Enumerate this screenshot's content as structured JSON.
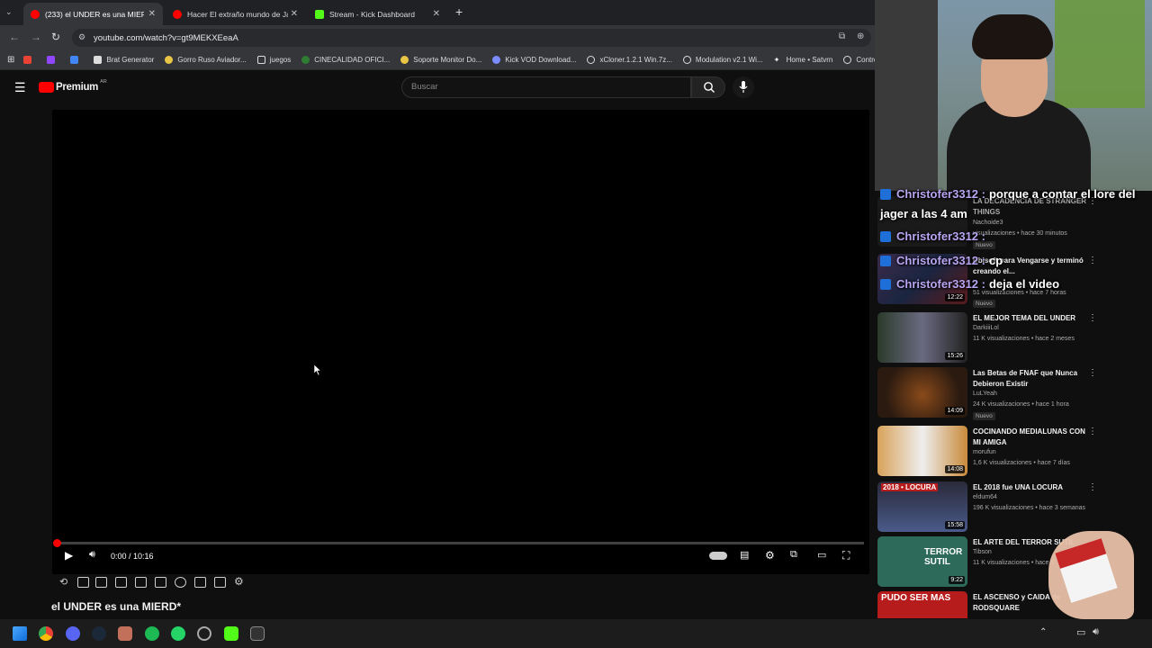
{
  "browser": {
    "tabs": [
      {
        "title": "(233) el UNDER es una MIERD*",
        "active": true
      },
      {
        "title": "Hacer El extraño mundo de Jac"
      },
      {
        "title": "Stream - Kick Dashboard"
      }
    ],
    "url": "youtube.com/watch?v=gt9MEKXEeaA",
    "bookmarks": [
      "Brat Generator",
      "Gorro Ruso Aviador...",
      "juegos",
      "CINECALIDAD OFICI...",
      "Soporte Monitor Do...",
      "Kick VOD Download...",
      "xCloner.1.2.1 Win.7z...",
      "Modulation v2.1 Wi...",
      "Home • Satvrn",
      "Control"
    ]
  },
  "youtube": {
    "logo": "Premium",
    "region": "AR",
    "search_placeholder": "Buscar"
  },
  "player": {
    "time": "0:00 / 10:16",
    "progress": 0
  },
  "video_title": "el UNDER es una MIERD*",
  "chat": [
    {
      "user": "Christofer3312 :",
      "msg": "porque a contar el lore del"
    },
    {
      "user": "",
      "msg": "jager a las 4 am"
    },
    {
      "user": "Christofer3312 :",
      "msg": ""
    },
    {
      "user": "Christofer3312 :",
      "msg": "cp"
    },
    {
      "user": "Christofer3312 :",
      "msg": "deja el video"
    }
  ],
  "sidebar": [
    {
      "title": "LA DECADENCIA DE STRANGER THINGS",
      "channel": "Nachoide3",
      "meta": "visualizaciones • hace 30 minutos",
      "badge": "Nuevo",
      "duration": ""
    },
    {
      "title": "Ubisoft para Vengarse y terminó creando el...",
      "channel": "",
      "meta": "51 visualizaciones • hace 7 horas",
      "badge": "Nuevo",
      "duration": "12:22"
    },
    {
      "title": "EL MEJOR TEMA DEL UNDER",
      "channel": "DarkiiiLol",
      "meta": "11 K visualizaciones • hace 2 meses",
      "badge": "",
      "duration": "15:26"
    },
    {
      "title": "Las Betas de FNAF que Nunca Debieron Existir",
      "channel": "LuLYeah",
      "meta": "24 K visualizaciones • hace 1 hora",
      "badge": "Nuevo",
      "duration": "14:09"
    },
    {
      "title": "COCINANDO MEDIALUNAS CON MI AMIGA",
      "channel": "morufun",
      "meta": "1,6 K visualizaciones • hace 7 días",
      "badge": "",
      "duration": "14:08"
    },
    {
      "title": "EL 2018 fue UNA LOCURA",
      "channel": "eldum64",
      "meta": "196 K visualizaciones • hace 3 semanas",
      "badge": "",
      "duration": "15:58",
      "thumb_text": "2018 • LOCURA"
    },
    {
      "title": "EL ARTE DEL TERROR SUTIL",
      "channel": "Tibson",
      "meta": "11 K visualizaciones • hace 4",
      "badge": "",
      "duration": "9:22",
      "thumb_text": "TERROR SUTIL"
    },
    {
      "title": "EL ASCENSO y CAIDA de RODSQUARE",
      "channel": "",
      "meta": "",
      "badge": "",
      "duration": "",
      "thumb_text": "PUDO SER MAS"
    }
  ],
  "colors": {
    "accent": "#ff0000",
    "kick": "#53fc18",
    "chat_user": "#b9a6f2"
  }
}
